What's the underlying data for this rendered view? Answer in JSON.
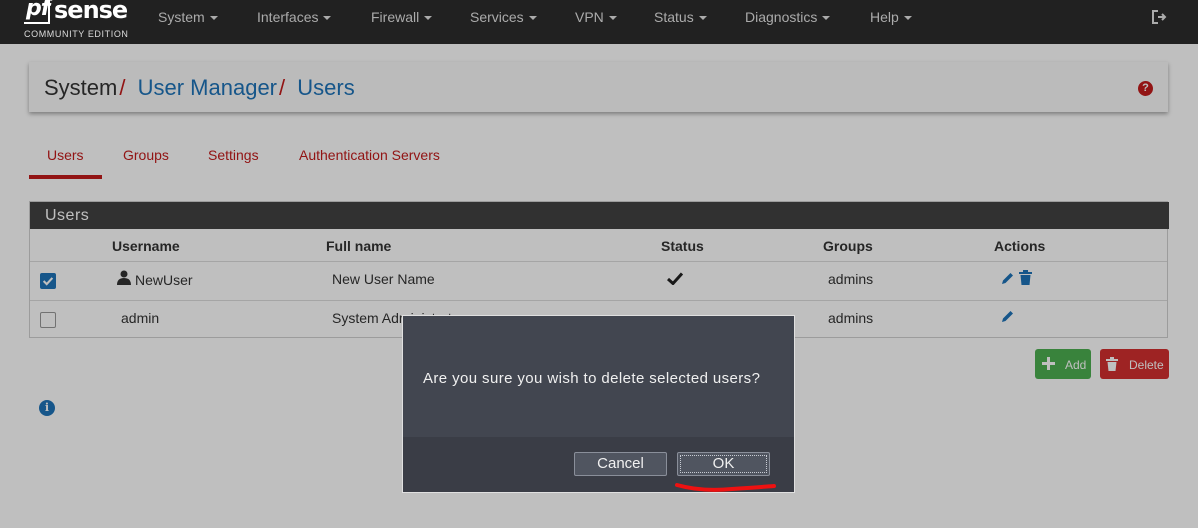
{
  "navbar": {
    "logo_main": "sense",
    "logo_pf": "pf",
    "logo_sub": "COMMUNITY EDITION",
    "menu": [
      {
        "label": "System"
      },
      {
        "label": "Interfaces"
      },
      {
        "label": "Firewall"
      },
      {
        "label": "Services"
      },
      {
        "label": "VPN"
      },
      {
        "label": "Status"
      },
      {
        "label": "Diagnostics"
      },
      {
        "label": "Help"
      }
    ]
  },
  "breadcrumb": {
    "root": "System",
    "sep": "/",
    "level1": "User Manager",
    "level2": "Users"
  },
  "tabs": [
    {
      "label": "Users",
      "active": true
    },
    {
      "label": "Groups"
    },
    {
      "label": "Settings"
    },
    {
      "label": "Authentication Servers"
    }
  ],
  "users_panel": {
    "title": "Users",
    "columns": [
      "Username",
      "Full name",
      "Status",
      "Groups",
      "Actions"
    ],
    "rows": [
      {
        "checked": true,
        "username": "NewUser",
        "full_name": "New User Name",
        "groups": "admins"
      },
      {
        "checked": false,
        "username": "admin",
        "full_name": "System Administrator",
        "groups": "admins"
      }
    ]
  },
  "buttons": {
    "add": "Add",
    "delete": "Delete"
  },
  "modal": {
    "message": "Are you sure you wish to delete selected users?",
    "cancel": "Cancel",
    "ok": "OK"
  },
  "colors": {
    "accent_red": "#c31b1b",
    "link_blue": "#1e73b8",
    "navbar_bg": "#212121",
    "panel_head": "#424242",
    "add_green": "#4caf50",
    "delete_red": "#d32f2f"
  }
}
